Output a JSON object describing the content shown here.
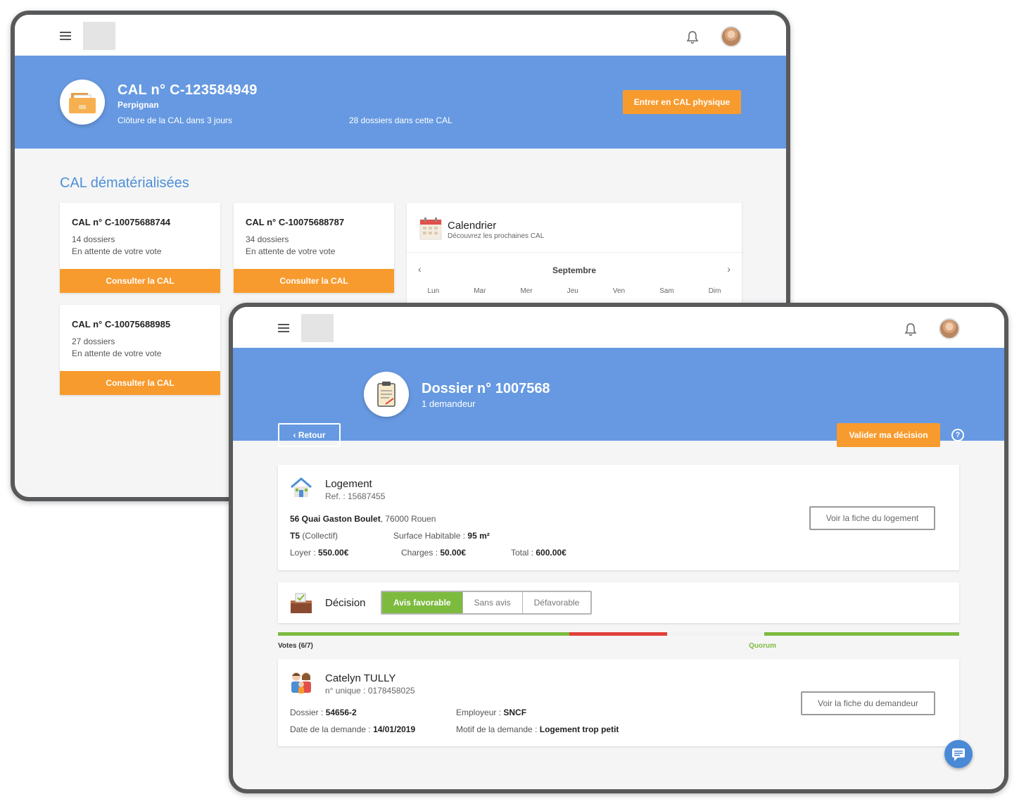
{
  "back": {
    "header": {
      "cal_title": "CAL n° C-123584949",
      "city": "Perpignan",
      "closing": "Clôture de la CAL dans 3 jours",
      "dossier_count": "28 dossiers dans cette CAL",
      "enter_button": "Entrer en CAL physique"
    },
    "section_title": "CAL dématérialisées",
    "cards": [
      {
        "title": "CAL n° C-10075688744",
        "dossiers": "14 dossiers",
        "status": "En attente de votre vote",
        "button": "Consulter la CAL"
      },
      {
        "title": "CAL n° C-10075688787",
        "dossiers": "34 dossiers",
        "status": "En attente de votre vote",
        "button": "Consulter la CAL"
      },
      {
        "title": "CAL n° C-10075688985",
        "dossiers": "27 dossiers",
        "status": "En attente de votre vote",
        "button": "Consulter la CAL"
      }
    ],
    "calendar": {
      "title": "Calendrier",
      "subtitle": "Découvrez les prochaines CAL",
      "month": "Septembre",
      "prev": "‹",
      "next": "›",
      "days": [
        "Lun",
        "Mar",
        "Mer",
        "Jeu",
        "Ven",
        "Sam",
        "Dim"
      ]
    }
  },
  "front": {
    "header": {
      "back_button": "Retour",
      "back_arrow": "‹",
      "title": "Dossier n° 1007568",
      "subtitle": "1 demandeur",
      "validate_button": "Valider ma décision",
      "help": "?"
    },
    "logement": {
      "title": "Logement",
      "ref": "Ref. : 15687455",
      "address_bold": "56 Quai Gaston Boulet",
      "address_rest": ", 76000 Rouen",
      "type_bold": "T5",
      "type_rest": " (Collectif)",
      "surface_label": "Surface Habitable : ",
      "surface_value": "95 m²",
      "loyer_label": "Loyer : ",
      "loyer_value": "550.00€",
      "charges_label": "Charges : ",
      "charges_value": "50.00€",
      "total_label": "Total : ",
      "total_value": "600.00€",
      "button": "Voir la fiche du logement"
    },
    "decision": {
      "title": "Décision",
      "options": [
        "Avis favorable",
        "Sans avis",
        "Défavorable"
      ],
      "selected": "Avis favorable"
    },
    "votes": {
      "label": "Votes (6/7)",
      "quorum_label": "Quorum",
      "segments": [
        {
          "share": 0.428,
          "color": "#7dbb3f"
        },
        {
          "share": 0.143,
          "color": "#e0403a"
        },
        {
          "share": 0.143,
          "color": "#f2f2f2"
        },
        {
          "share": 0.286,
          "color": "#7dbb3f"
        }
      ]
    },
    "demandeur": {
      "name": "Catelyn TULLY",
      "unique": "n° unique : 0178458025",
      "dossier_label": "Dossier : ",
      "dossier_value": "54656-2",
      "date_label": "Date de la demande : ",
      "date_value": "14/01/2019",
      "employer_label": "Employeur : ",
      "employer_value": "SNCF",
      "motif_label": "Motif de la demande : ",
      "motif_value": "Logement trop petit",
      "button": "Voir la fiche du demandeur"
    }
  },
  "colors": {
    "banner": "#6699e1",
    "accent_orange": "#f89b2e",
    "favorable_green": "#7dbb3f",
    "section_blue": "#4d8fd6"
  }
}
